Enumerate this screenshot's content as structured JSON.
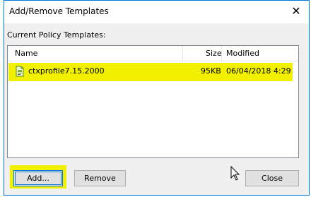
{
  "window": {
    "title": "Add/Remove Templates",
    "close_icon": "close-icon"
  },
  "group_label": "Current Policy Templates:",
  "list": {
    "columns": {
      "name": "Name",
      "size": "Size",
      "modified": "Modified"
    },
    "rows": [
      {
        "icon": "template-file-icon",
        "name": "ctxprofile7.15.2000",
        "size": "95KB",
        "modified": "06/04/2018 4:29"
      }
    ]
  },
  "buttons": {
    "add": "Add...",
    "remove": "Remove",
    "close": "Close"
  },
  "colors": {
    "highlight": "#f0f000",
    "accent": "#0078d7",
    "button_face": "#e1e1e1"
  }
}
